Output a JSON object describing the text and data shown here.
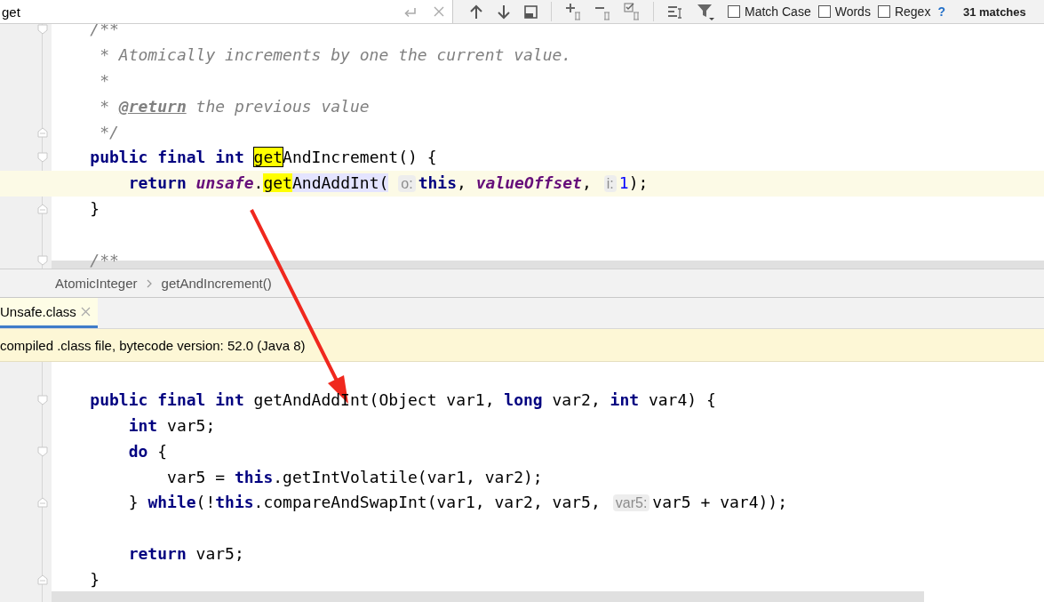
{
  "search": {
    "value": "get"
  },
  "options": [
    {
      "label": "Match Case",
      "checked": false
    },
    {
      "label": "Words",
      "checked": false
    },
    {
      "label": "Regex",
      "checked": false
    }
  ],
  "help": "?",
  "match_count": "31 matches",
  "editor": {
    "lines": [
      {
        "fold_start": true,
        "tokens": [
          {
            "kind": "doc",
            "text": "    /**"
          }
        ]
      },
      {
        "tokens": [
          {
            "kind": "doc",
            "text": "     * Atomically increments by one the current value."
          }
        ]
      },
      {
        "tokens": [
          {
            "kind": "doc",
            "text": "     *"
          }
        ]
      },
      {
        "tokens": [
          {
            "kind": "doc",
            "text": "     * "
          },
          {
            "kind": "doctag",
            "text": "@return"
          },
          {
            "kind": "doc",
            "text": " the previous value"
          }
        ]
      },
      {
        "fold_end": true,
        "tokens": [
          {
            "kind": "doc",
            "text": "     */"
          }
        ]
      },
      {
        "fold_start": true,
        "tokens": [
          {
            "kind": "kw",
            "text": "    public final int "
          },
          {
            "kind": "cur",
            "text": "get"
          },
          {
            "kind": "plain",
            "text": "AndIncrement() {"
          }
        ]
      },
      {
        "current": true,
        "tokens": [
          {
            "kind": "kw",
            "text": "        return "
          },
          {
            "kind": "field",
            "text": "unsafe"
          },
          {
            "kind": "plain",
            "text": "."
          },
          {
            "kind": "match",
            "text": "get"
          },
          {
            "kind": "ref",
            "text": "AndAddInt("
          },
          {
            "kind": "hint",
            "text": "o:"
          },
          {
            "kind": "kw",
            "text": "this"
          },
          {
            "kind": "plain",
            "text": ", "
          },
          {
            "kind": "field",
            "text": "valueOffset"
          },
          {
            "kind": "plain",
            "text": ","
          },
          {
            "kind": "hint",
            "text": "i:"
          },
          {
            "kind": "num",
            "text": "1"
          },
          {
            "kind": "plain",
            "text": ");"
          }
        ]
      },
      {
        "fold_end": true,
        "tokens": [
          {
            "kind": "plain",
            "text": "    }"
          }
        ]
      },
      {
        "kind": "blank"
      },
      {
        "kind": "code",
        "fold_start": true,
        "tokens": [
          {
            "kind": "doc",
            "text": "    /**"
          }
        ]
      }
    ]
  },
  "breadcrumbs": [
    "AtomicInteger",
    "getAndIncrement()"
  ],
  "tabs": [
    {
      "label": "Unsafe.class",
      "selected": true
    }
  ],
  "banner": "compiled .class file, bytecode version: 52.0 (Java 8)",
  "decompiled": {
    "lines": [
      {
        "kind": "blank"
      },
      {
        "kind": "code",
        "fold_start": true,
        "tokens": [
          {
            "kind": "kw",
            "text": "    public final int "
          },
          {
            "kind": "plain",
            "text": "getAndAddInt(Object var1, "
          },
          {
            "kind": "kw",
            "text": "long "
          },
          {
            "kind": "plain",
            "text": "var2, "
          },
          {
            "kind": "kw",
            "text": "int "
          },
          {
            "kind": "plain",
            "text": "var4) {"
          }
        ]
      },
      {
        "tokens": [
          {
            "kind": "kw",
            "text": "        int "
          },
          {
            "kind": "plain",
            "text": "var5;"
          }
        ]
      },
      {
        "fold_start": true,
        "tokens": [
          {
            "kind": "kw",
            "text": "        do "
          },
          {
            "kind": "plain",
            "text": "{"
          }
        ]
      },
      {
        "tokens": [
          {
            "kind": "plain",
            "text": "            var5 = "
          },
          {
            "kind": "kw",
            "text": "this"
          },
          {
            "kind": "plain",
            "text": ".getIntVolatile(var1, var2);"
          }
        ]
      },
      {
        "fold_end": true,
        "tokens": [
          {
            "kind": "plain",
            "text": "        } "
          },
          {
            "kind": "kw",
            "text": "while"
          },
          {
            "kind": "plain",
            "text": "(!"
          },
          {
            "kind": "kw",
            "text": "this"
          },
          {
            "kind": "plain",
            "text": ".compareAndSwapInt(var1, var2, var5,"
          },
          {
            "kind": "hint",
            "text": "var5:"
          },
          {
            "kind": "plain",
            "text": "var5 + var4));"
          }
        ]
      },
      {
        "kind": "blank"
      },
      {
        "kind": "code",
        "tokens": [
          {
            "kind": "kw",
            "text": "        return "
          },
          {
            "kind": "plain",
            "text": "var5;"
          }
        ]
      },
      {
        "fold_end": true,
        "tokens": [
          {
            "kind": "plain",
            "text": "    }"
          }
        ]
      }
    ]
  }
}
